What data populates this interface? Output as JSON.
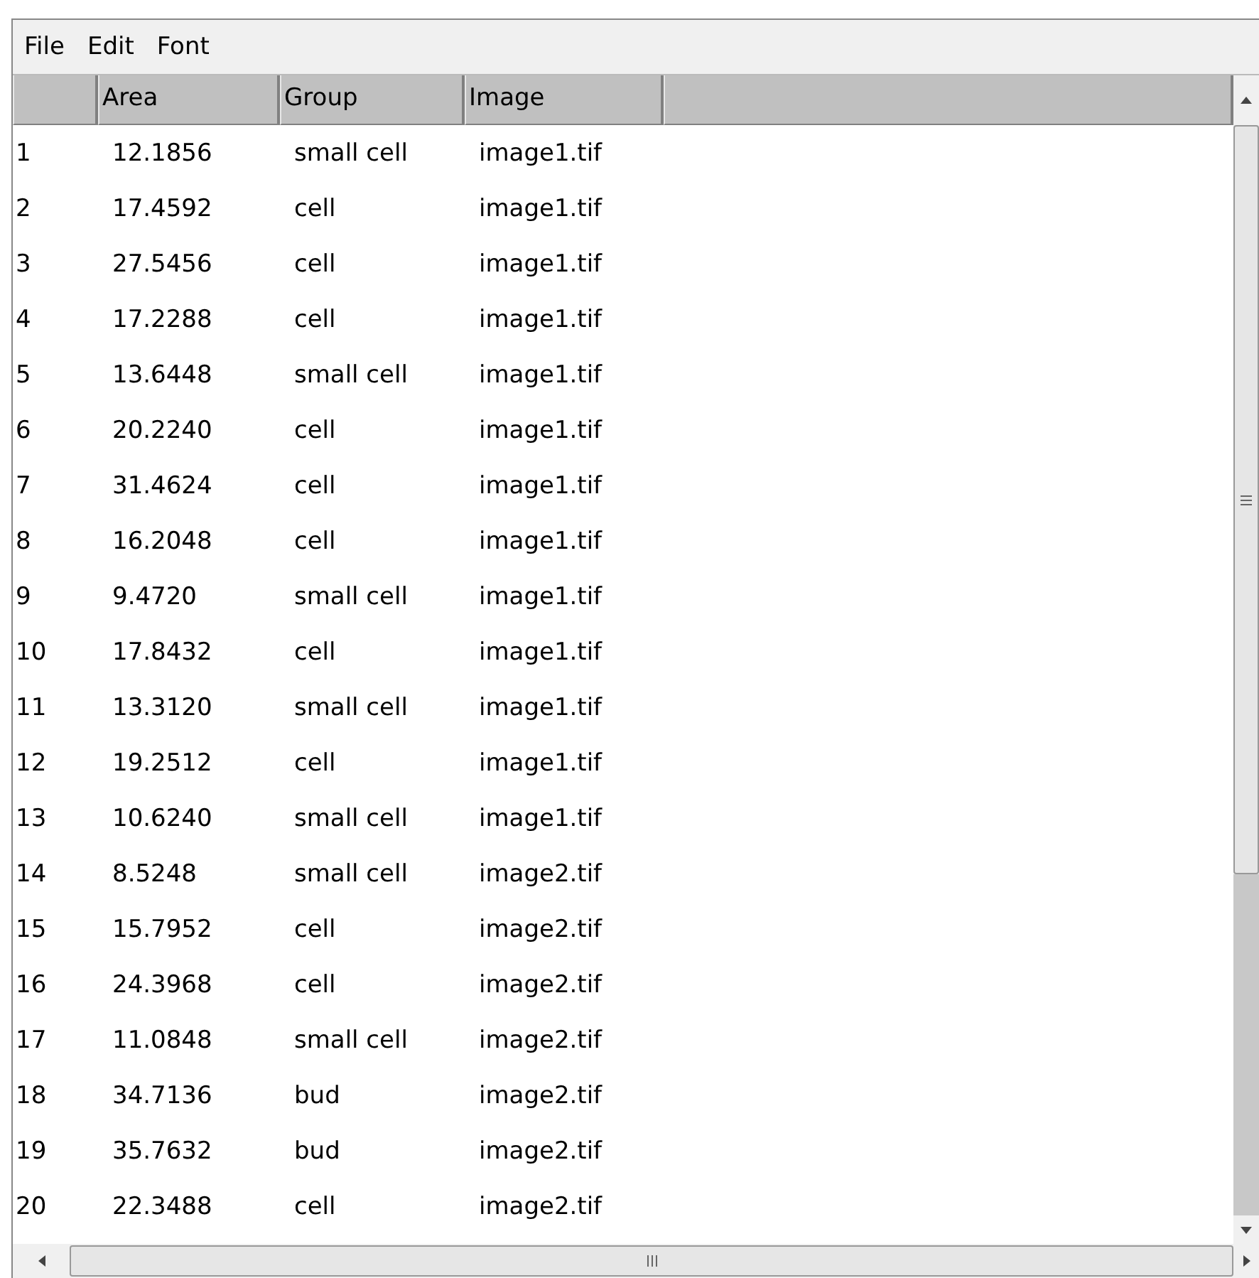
{
  "menu": [
    "File",
    "Edit",
    "Font"
  ],
  "table": {
    "columns": [
      "",
      "Area",
      "Group",
      "Image"
    ],
    "rows": [
      [
        "1",
        "12.1856",
        "small cell",
        "image1.tif"
      ],
      [
        "2",
        "17.4592",
        "cell",
        "image1.tif"
      ],
      [
        "3",
        "27.5456",
        "cell",
        "image1.tif"
      ],
      [
        "4",
        "17.2288",
        "cell",
        "image1.tif"
      ],
      [
        "5",
        "13.6448",
        "small cell",
        "image1.tif"
      ],
      [
        "6",
        "20.2240",
        "cell",
        "image1.tif"
      ],
      [
        "7",
        "31.4624",
        "cell",
        "image1.tif"
      ],
      [
        "8",
        "16.2048",
        "cell",
        "image1.tif"
      ],
      [
        "9",
        "9.4720",
        "small cell",
        "image1.tif"
      ],
      [
        "10",
        "17.8432",
        "cell",
        "image1.tif"
      ],
      [
        "11",
        "13.3120",
        "small cell",
        "image1.tif"
      ],
      [
        "12",
        "19.2512",
        "cell",
        "image1.tif"
      ],
      [
        "13",
        "10.6240",
        "small cell",
        "image1.tif"
      ],
      [
        "14",
        "8.5248",
        "small cell",
        "image2.tif"
      ],
      [
        "15",
        "15.7952",
        "cell",
        "image2.tif"
      ],
      [
        "16",
        "24.3968",
        "cell",
        "image2.tif"
      ],
      [
        "17",
        "11.0848",
        "small cell",
        "image2.tif"
      ],
      [
        "18",
        "34.7136",
        "bud",
        "image2.tif"
      ],
      [
        "19",
        "35.7632",
        "bud",
        "image2.tif"
      ],
      [
        "20",
        "22.3488",
        "cell",
        "image2.tif"
      ]
    ]
  }
}
